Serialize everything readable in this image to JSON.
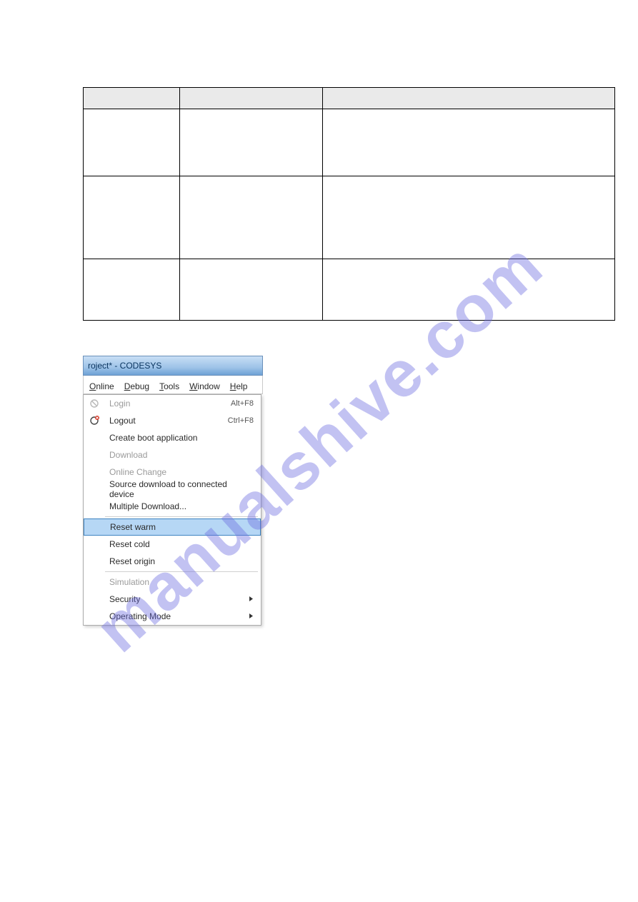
{
  "watermark_text": "manualshive.com",
  "table": {
    "rows": [
      {
        "link_texts": [
          ""
        ],
        "link_widths": [
          128
        ]
      },
      {
        "link_texts": [
          "",
          "",
          "",
          ""
        ],
        "link_widths": [
          158,
          144,
          158,
          36
        ]
      },
      {
        "link_texts": [
          "",
          ""
        ],
        "link_widths": [
          158,
          44
        ]
      }
    ]
  },
  "screenshot": {
    "title": "roject* - CODESYS",
    "menubar": [
      {
        "label": "Online",
        "u": "O"
      },
      {
        "label": "Debug",
        "u": "D"
      },
      {
        "label": "Tools",
        "u": "T"
      },
      {
        "label": "Window",
        "u": "W"
      },
      {
        "label": "Help",
        "u": "H"
      }
    ],
    "items": [
      {
        "label": "Login",
        "u": "L",
        "shortcut": "Alt+F8",
        "disabled": true,
        "icon": "login-icon"
      },
      {
        "label": "Logout",
        "u": "",
        "shortcut": "Ctrl+F8",
        "disabled": false,
        "icon": "logout-icon"
      },
      {
        "label": "Create boot application",
        "u": "C",
        "shortcut": "",
        "disabled": false
      },
      {
        "label": "Download",
        "u": "D",
        "shortcut": "",
        "disabled": true
      },
      {
        "label": "Online Change",
        "u": "",
        "shortcut": "",
        "disabled": true
      },
      {
        "label": "Source download to connected device",
        "u": "S",
        "shortcut": "",
        "disabled": false
      },
      {
        "label": "Multiple Download...",
        "u": "M",
        "shortcut": "",
        "disabled": false
      },
      {
        "sep": true
      },
      {
        "label": "Reset warm",
        "u": "R",
        "shortcut": "",
        "disabled": false,
        "selected": true
      },
      {
        "label": "Reset cold",
        "u": "",
        "shortcut": "",
        "disabled": false
      },
      {
        "label": "Reset origin",
        "u": "",
        "shortcut": "",
        "disabled": false
      },
      {
        "sep": true
      },
      {
        "label": "Simulation",
        "u": "",
        "shortcut": "",
        "disabled": true
      },
      {
        "label": "Security",
        "u": "",
        "shortcut": "",
        "disabled": false,
        "submenu": true
      },
      {
        "label": "Operating Mode",
        "u": "O",
        "shortcut": "",
        "disabled": false,
        "submenu": true
      }
    ]
  }
}
